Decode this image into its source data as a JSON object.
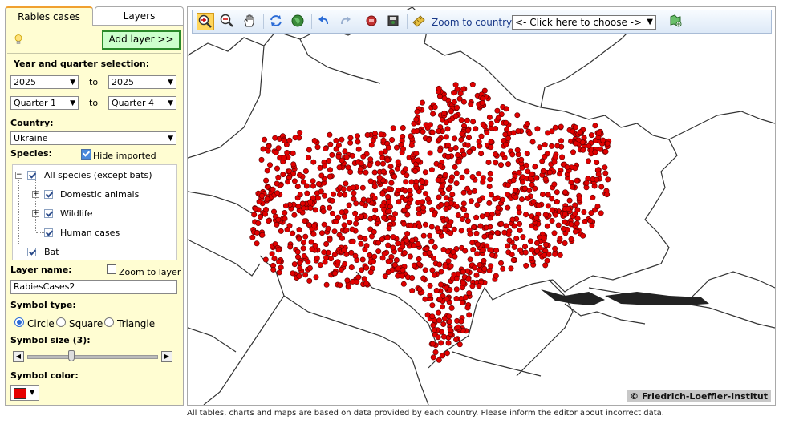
{
  "tabs": [
    {
      "label": "Rabies cases",
      "active": true
    },
    {
      "label": "Layers",
      "active": false
    }
  ],
  "panel": {
    "add_layer_label": "Add layer >>",
    "year_quarter_label": "Year and quarter selection:",
    "year_from": "2025",
    "year_to": "2025",
    "to_label": "to",
    "quarter_from": "Quarter 1",
    "quarter_to": "Quarter 4",
    "country_label": "Country:",
    "country_value": "Ukraine",
    "species_label": "Species:",
    "hide_imported_label": "Hide imported cases",
    "species_tree": {
      "all_label": "All species (except bats)",
      "domestic_label": "Domestic animals",
      "wildlife_label": "Wildlife",
      "human_label": "Human cases",
      "bat_label": "Bat"
    },
    "layer_name_label": "Layer name:",
    "zoom_to_layer_label": "Zoom to layer",
    "layer_name_value": "RabiesCases2",
    "symbol_type_label": "Symbol type:",
    "symbol_types": [
      "Circle",
      "Square",
      "Triangle"
    ],
    "symbol_size_label": "Symbol size (3):",
    "symbol_size_fraction": 0.34,
    "symbol_color_label": "Symbol color:",
    "symbol_color": "#e60000"
  },
  "toolbar": {
    "icons": [
      "zoom-in-icon",
      "zoom-out-icon",
      "pan-hand-icon",
      "refresh-icon",
      "globe-icon",
      "undo-icon",
      "redo-icon",
      "stop-icon",
      "save-icon",
      "measure-icon",
      "print-icon"
    ],
    "zoom_country_label": "Zoom to country:",
    "zoom_country_value": "<- Click here to choose ->"
  },
  "map": {
    "copyright": "© Friedrich-Loeffler-Institut",
    "point_color": "#e00000",
    "border_color": "#333333"
  },
  "footer": "All tables, charts and maps are based on data provided by each country. Please inform the editor about incorrect data."
}
